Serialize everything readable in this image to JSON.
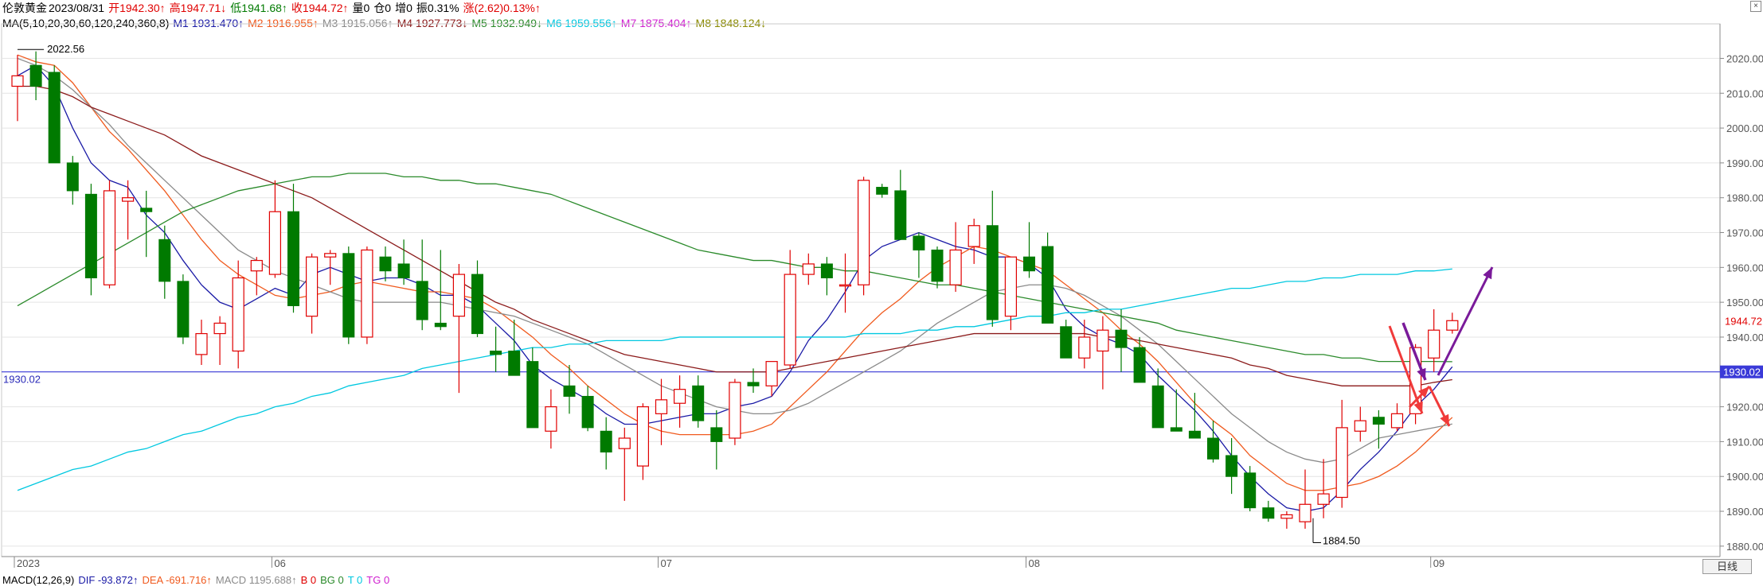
{
  "header": {
    "instrument": "伦敦黄金",
    "date": "2023/08/31",
    "open": "开1942.30↑",
    "high": "高1947.71↓",
    "low": "低1941.68↑",
    "close": "收1944.72↑",
    "volume": "量0",
    "position": "仓0",
    "increase": "增0",
    "amplitude": "振0.31%",
    "change": "涨(2.62)0.13%↑"
  },
  "ma_line": {
    "label": "MA(5,10,20,30,60,120,240,360,8)",
    "items": [
      {
        "text": "M1 1931.470↑",
        "color": "#1a1aa6"
      },
      {
        "text": "M2 1916.955↑",
        "color": "#f05a1e"
      },
      {
        "text": "M3 1915.056↑",
        "color": "#8a8a8a"
      },
      {
        "text": "M4 1927.773↓",
        "color": "#8b1a1a"
      },
      {
        "text": "M5 1932.949↓",
        "color": "#2a8a2a"
      },
      {
        "text": "M6 1959.556↑",
        "color": "#00c8e0"
      },
      {
        "text": "M7 1875.404↑",
        "color": "#d020d0"
      },
      {
        "text": "M8 1848.124↓",
        "color": "#8a8a00"
      }
    ]
  },
  "macd": {
    "label": "MACD(12,26,9)",
    "items": [
      {
        "text": "DIF -93.872↑",
        "color": "#1a1aa6"
      },
      {
        "text": "DEA -691.716↑",
        "color": "#f05a1e"
      },
      {
        "text": "MACD 1195.688↑",
        "color": "#8a8a8a"
      },
      {
        "text": "B 0",
        "color": "#e00000"
      },
      {
        "text": "BG 0",
        "color": "#2a8a2a"
      },
      {
        "text": "T 0",
        "color": "#00c8e0"
      },
      {
        "text": "TG 0",
        "color": "#d020d0"
      }
    ]
  },
  "period_tab": "日线",
  "chart_data": {
    "type": "candlestick",
    "ylim": [
      1877,
      2029
    ],
    "y_ticks": [
      "1880.00",
      "1890.00",
      "1900.00",
      "1910.00",
      "1920.00",
      "1930.00",
      "1940.00",
      "1950.00",
      "1960.00",
      "1970.00",
      "1980.00",
      "1990.00",
      "2000.00",
      "2010.00",
      "2020.00"
    ],
    "x_labels": [
      {
        "label": "2023",
        "index": 0
      },
      {
        "label": "06",
        "index": 14
      },
      {
        "label": "07",
        "index": 35
      },
      {
        "label": "08",
        "index": 55
      },
      {
        "label": "09",
        "index": 77
      }
    ],
    "candles": [
      [
        2012,
        2021,
        2002,
        2015
      ],
      [
        2018,
        2022,
        2008,
        2012
      ],
      [
        2016,
        2018,
        1990,
        1990
      ],
      [
        1990,
        1992,
        1978,
        1982
      ],
      [
        1981,
        1984,
        1952,
        1957
      ],
      [
        1955,
        1985,
        1954,
        1982
      ],
      [
        1979,
        1985,
        1968,
        1980
      ],
      [
        1977,
        1982,
        1963,
        1976
      ],
      [
        1968,
        1972,
        1951,
        1956
      ],
      [
        1956,
        1958,
        1938,
        1940
      ],
      [
        1935,
        1945,
        1932,
        1941
      ],
      [
        1941,
        1946,
        1932,
        1944
      ],
      [
        1936,
        1962,
        1931,
        1957
      ],
      [
        1959,
        1963,
        1952,
        1962
      ],
      [
        1958,
        1985,
        1957,
        1976
      ],
      [
        1976,
        1984,
        1947,
        1949
      ],
      [
        1946,
        1964,
        1941,
        1963
      ],
      [
        1963,
        1965,
        1955,
        1964
      ],
      [
        1964,
        1966,
        1938,
        1940
      ],
      [
        1940,
        1966,
        1938,
        1965
      ],
      [
        1963,
        1966,
        1956,
        1959
      ],
      [
        1961,
        1968,
        1955,
        1957
      ],
      [
        1956,
        1968,
        1942,
        1945
      ],
      [
        1944,
        1965,
        1942,
        1943
      ],
      [
        1946,
        1961,
        1924,
        1958
      ],
      [
        1958,
        1962,
        1940,
        1941
      ],
      [
        1936,
        1943,
        1930,
        1935
      ],
      [
        1936,
        1945,
        1929,
        1929
      ],
      [
        1933,
        1937,
        1920,
        1914
      ],
      [
        1913,
        1925,
        1908,
        1920
      ],
      [
        1926,
        1932,
        1918,
        1923
      ],
      [
        1923,
        1926,
        1913,
        1914
      ],
      [
        1913,
        1917,
        1902,
        1907
      ],
      [
        1908,
        1914,
        1893,
        1911
      ],
      [
        1903,
        1921,
        1899,
        1920
      ],
      [
        1918,
        1928,
        1909,
        1922
      ],
      [
        1921,
        1929,
        1914,
        1925
      ],
      [
        1926,
        1929,
        1914,
        1916
      ],
      [
        1914,
        1919,
        1902,
        1910
      ],
      [
        1911,
        1928,
        1909,
        1927
      ],
      [
        1927,
        1931,
        1924,
        1926
      ],
      [
        1926,
        1929,
        1923,
        1933
      ],
      [
        1932,
        1965,
        1931,
        1958
      ],
      [
        1958,
        1964,
        1955,
        1961
      ],
      [
        1961,
        1963,
        1952,
        1957
      ],
      [
        1955,
        1964,
        1947,
        1955
      ],
      [
        1955,
        1986,
        1952,
        1985
      ],
      [
        1983,
        1984,
        1980,
        1981
      ],
      [
        1982,
        1988,
        1968,
        1968
      ],
      [
        1969,
        1970,
        1957,
        1965
      ],
      [
        1965,
        1966,
        1954,
        1956
      ],
      [
        1955,
        1973,
        1953,
        1965
      ],
      [
        1966,
        1974,
        1961,
        1972
      ],
      [
        1972,
        1982,
        1943,
        1945
      ],
      [
        1946,
        1963,
        1942,
        1963
      ],
      [
        1963,
        1973,
        1957,
        1959
      ],
      [
        1966,
        1970,
        1944,
        1944
      ],
      [
        1943,
        1945,
        1935,
        1934
      ],
      [
        1934,
        1945,
        1931,
        1940
      ],
      [
        1936,
        1946,
        1925,
        1942
      ],
      [
        1942,
        1948,
        1930,
        1937
      ],
      [
        1937,
        1940,
        1927,
        1927
      ],
      [
        1926,
        1931,
        1915,
        1914
      ],
      [
        1914,
        1925,
        1914,
        1913
      ],
      [
        1913,
        1924,
        1911,
        1911
      ],
      [
        1911,
        1916,
        1904,
        1905
      ],
      [
        1906,
        1911,
        1895,
        1900
      ],
      [
        1901,
        1903,
        1890,
        1891
      ],
      [
        1891,
        1893,
        1887,
        1888
      ],
      [
        1888,
        1890,
        1885,
        1889
      ],
      [
        1887,
        1902,
        1885,
        1892
      ],
      [
        1892,
        1905,
        1888,
        1895
      ],
      [
        1894,
        1922,
        1891,
        1914
      ],
      [
        1913,
        1920,
        1910,
        1916
      ],
      [
        1917,
        1919,
        1908,
        1915
      ],
      [
        1914,
        1921,
        1913,
        1918
      ],
      [
        1918,
        1938,
        1915,
        1937
      ],
      [
        1934,
        1948,
        1930,
        1942
      ],
      [
        1942,
        1947,
        1941,
        1944.72
      ]
    ],
    "series": [
      {
        "name": "M1",
        "color": "#1a1aa6",
        "values": [
          2015,
          2018,
          2012,
          2000,
          1990,
          1985,
          1983,
          1975,
          1970,
          1962,
          1955,
          1950,
          1948,
          1951,
          1954,
          1952,
          1958,
          1960,
          1958,
          1956,
          1957,
          1957,
          1955,
          1952,
          1952,
          1949,
          1944,
          1939,
          1932,
          1928,
          1925,
          1922,
          1918,
          1915,
          1915,
          1916,
          1917,
          1918,
          1918,
          1920,
          1921,
          1923,
          1930,
          1939,
          1945,
          1953,
          1962,
          1966,
          1968,
          1970,
          1968,
          1966,
          1965,
          1963,
          1963,
          1961,
          1957,
          1948,
          1943,
          1940,
          1938,
          1935,
          1929,
          1924,
          1919,
          1913,
          1906,
          1900,
          1895,
          1891,
          1890,
          1891,
          1896,
          1902,
          1907,
          1913,
          1920,
          1925,
          1931.47
        ]
      },
      {
        "name": "M2",
        "color": "#f05a1e",
        "values": [
          2021,
          2019,
          2018,
          2013,
          2006,
          1999,
          1994,
          1988,
          1982,
          1975,
          1968,
          1962,
          1958,
          1955,
          1952,
          1951,
          1952,
          1953,
          1955,
          1956,
          1955,
          1954,
          1953,
          1953,
          1952,
          1951,
          1948,
          1944,
          1940,
          1935,
          1931,
          1926,
          1922,
          1918,
          1915,
          1913,
          1912,
          1912,
          1912,
          1912,
          1913,
          1915,
          1920,
          1925,
          1930,
          1936,
          1942,
          1947,
          1951,
          1956,
          1960,
          1963,
          1966,
          1965,
          1963,
          1961,
          1959,
          1955,
          1951,
          1947,
          1942,
          1938,
          1933,
          1927,
          1921,
          1916,
          1912,
          1906,
          1902,
          1898,
          1896,
          1896,
          1897,
          1898,
          1900,
          1903,
          1907,
          1912,
          1916.955
        ]
      },
      {
        "name": "M3",
        "color": "#8a8a8a",
        "values": [
          2020,
          2018,
          2015,
          2011,
          2006,
          2001,
          1995,
          1990,
          1985,
          1980,
          1975,
          1970,
          1965,
          1962,
          1959,
          1957,
          1955,
          1953,
          1951,
          1950,
          1950,
          1950,
          1950,
          1950,
          1949,
          1948,
          1947,
          1946,
          1944,
          1942,
          1940,
          1938,
          1935,
          1932,
          1929,
          1926,
          1924,
          1922,
          1920,
          1919,
          1918,
          1918,
          1919,
          1921,
          1924,
          1927,
          1930,
          1933,
          1936,
          1940,
          1944,
          1947,
          1950,
          1953,
          1954,
          1955,
          1955,
          1954,
          1952,
          1949,
          1946,
          1942,
          1938,
          1933,
          1928,
          1923,
          1918,
          1914,
          1910,
          1907,
          1905,
          1904,
          1905,
          1908,
          1911,
          1912,
          1913,
          1914,
          1915.056
        ]
      },
      {
        "name": "M4",
        "color": "#8b1a1a",
        "values": [
          2012,
          2012,
          2011,
          2009,
          2006,
          2004,
          2002,
          2000,
          1998,
          1995,
          1992,
          1990,
          1988,
          1986,
          1984,
          1982,
          1980,
          1977,
          1974,
          1971,
          1968,
          1965,
          1962,
          1959,
          1956,
          1953,
          1950,
          1948,
          1945,
          1943,
          1941,
          1939,
          1937,
          1935,
          1934,
          1933,
          1932,
          1931,
          1930,
          1930,
          1930,
          1930,
          1931,
          1932,
          1933,
          1934,
          1935,
          1936,
          1937,
          1938,
          1939,
          1940,
          1941,
          1941,
          1941,
          1941,
          1941,
          1941,
          1941,
          1940,
          1940,
          1939,
          1938,
          1937,
          1936,
          1935,
          1934,
          1932,
          1931,
          1929,
          1928,
          1927,
          1926,
          1926,
          1926,
          1926,
          1926,
          1927,
          1927.773
        ]
      },
      {
        "name": "M5",
        "color": "#2a8a2a",
        "values": [
          1949,
          1952,
          1955,
          1958,
          1961,
          1964,
          1967,
          1970,
          1973,
          1976,
          1978,
          1980,
          1982,
          1983,
          1984,
          1985,
          1986,
          1986,
          1987,
          1987,
          1987,
          1986,
          1986,
          1985,
          1985,
          1984,
          1984,
          1983,
          1982,
          1981,
          1979,
          1977,
          1975,
          1973,
          1971,
          1969,
          1967,
          1965,
          1964,
          1963,
          1962,
          1962,
          1961,
          1960,
          1960,
          1959,
          1959,
          1958,
          1957,
          1956,
          1955,
          1955,
          1954,
          1953,
          1952,
          1951,
          1950,
          1949,
          1948,
          1947,
          1946,
          1945,
          1944,
          1942,
          1941,
          1940,
          1939,
          1938,
          1937,
          1936,
          1935,
          1935,
          1934,
          1934,
          1933,
          1933,
          1933,
          1933,
          1932.949
        ]
      },
      {
        "name": "M6",
        "color": "#00c8e0",
        "values": [
          1896,
          1898,
          1900,
          1902,
          1903,
          1905,
          1907,
          1908,
          1910,
          1912,
          1913,
          1915,
          1917,
          1918,
          1920,
          1921,
          1923,
          1924,
          1926,
          1927,
          1928,
          1929,
          1931,
          1932,
          1933,
          1934,
          1935,
          1936,
          1937,
          1937,
          1938,
          1938,
          1939,
          1939,
          1939,
          1939,
          1940,
          1940,
          1940,
          1940,
          1940,
          1940,
          1940,
          1940,
          1940,
          1940,
          1941,
          1941,
          1941,
          1942,
          1942,
          1943,
          1943,
          1944,
          1945,
          1946,
          1946,
          1947,
          1947,
          1948,
          1948,
          1949,
          1950,
          1951,
          1952,
          1953,
          1954,
          1954,
          1955,
          1956,
          1956,
          1957,
          1957,
          1958,
          1958,
          1958,
          1959,
          1959,
          1959.556
        ]
      }
    ],
    "annotations": {
      "max_label": "2022.56",
      "min_label": "1884.50",
      "hline_label": "1930.02",
      "hline_value": 1930.02,
      "last_price_label": "1944.72"
    }
  }
}
